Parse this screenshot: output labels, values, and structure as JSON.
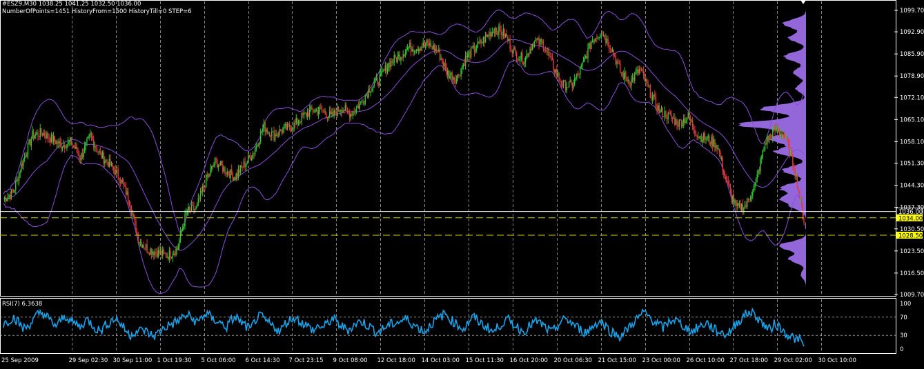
{
  "header": {
    "symbol_line": "#ESZ9,M30  1038.25 1041.25 1032.50 1036.00",
    "params_line": "NumberOfPoints=1451 HistoryFrom=1500 HistoryTill=0 STEP=6"
  },
  "colors": {
    "background": "#000000",
    "candle_up": "#32c832",
    "candle_down": "#e03c3c",
    "bands": "#8a4fd6",
    "profile": "#9b6be6",
    "rsi_line": "#1aa3ea",
    "grid": "#b4b4b4",
    "level_line": "#d2d200",
    "price_line": "#ffffff",
    "axis_text": "#ffffff",
    "tag_yellow": "#ffff00"
  },
  "chart_data": [
    {
      "type": "candlestick",
      "symbol": "#ESZ9",
      "timeframe": "M30",
      "ohlc_last": {
        "open": 1038.25,
        "high": 1041.25,
        "low": 1032.5,
        "close": 1036.0
      },
      "ylim": [
        1009.7,
        1103.5
      ],
      "y_ticks": [
        "1099.70",
        "1092.90",
        "1085.90",
        "1078.90",
        "1072.10",
        "1065.10",
        "1058.10",
        "1051.30",
        "1044.30",
        "1037.30",
        "1030.50",
        "1023.50",
        "1016.50",
        "1009.70"
      ],
      "x_ticks": [
        "25 Sep 2009",
        "29 Sep 02:30",
        "30 Sep 11:00",
        "1 Oct 19:30",
        "5 Oct 06:00",
        "6 Oct 14:30",
        "7 Oct 23:15",
        "9 Oct 08:00",
        "12 Oct 18:00",
        "14 Oct 03:00",
        "15 Oct 11:30",
        "16 Oct 20:00",
        "20 Oct 06:30",
        "21 Oct 15:00",
        "23 Oct 00:00",
        "26 Oct 10:00",
        "27 Oct 18:00",
        "29 Oct 02:00",
        "30 Oct 10:00"
      ],
      "price_path": [
        1040,
        1042,
        1052,
        1060,
        1061,
        1059,
        1057,
        1058,
        1053,
        1060,
        1054,
        1051,
        1047,
        1040,
        1027,
        1024,
        1023,
        1022,
        1024,
        1036,
        1037,
        1046,
        1052,
        1049,
        1047,
        1051,
        1055,
        1063,
        1060,
        1062,
        1063,
        1066,
        1068,
        1068,
        1066,
        1069,
        1067,
        1070,
        1075,
        1078,
        1083,
        1085,
        1088,
        1088,
        1089,
        1087,
        1080,
        1078,
        1085,
        1088,
        1091,
        1094,
        1092,
        1086,
        1084,
        1090,
        1089,
        1082,
        1076,
        1076,
        1082,
        1090,
        1093,
        1088,
        1080,
        1077,
        1081,
        1074,
        1068,
        1066,
        1064,
        1066,
        1060,
        1059,
        1057,
        1045,
        1037,
        1038,
        1045,
        1058,
        1062,
        1060,
        1050,
        1033
      ],
      "price_line": {
        "value": 1036.0,
        "label": "1036.00"
      },
      "levels": [
        {
          "value": 1034.0,
          "label": "1034.00"
        },
        {
          "value": 1028.5,
          "label": "1028.50"
        }
      ],
      "volume_profile_peaks": [
        {
          "price": 1095.5,
          "weight": 0.28
        },
        {
          "price": 1091.0,
          "weight": 0.2
        },
        {
          "price": 1085.0,
          "weight": 0.26
        },
        {
          "price": 1080.0,
          "weight": 0.16
        },
        {
          "price": 1075.0,
          "weight": 0.12
        },
        {
          "price": 1068.5,
          "weight": 0.52
        },
        {
          "price": 1063.5,
          "weight": 0.8
        },
        {
          "price": 1059.0,
          "weight": 0.44
        },
        {
          "price": 1055.0,
          "weight": 0.36
        },
        {
          "price": 1049.0,
          "weight": 0.28
        },
        {
          "price": 1043.5,
          "weight": 0.3
        },
        {
          "price": 1040.0,
          "weight": 0.26
        },
        {
          "price": 1037.5,
          "weight": 0.14
        },
        {
          "price": 1025.0,
          "weight": 0.32
        },
        {
          "price": 1021.0,
          "weight": 0.2
        },
        {
          "price": 1016.0,
          "weight": 0.06
        }
      ]
    },
    {
      "type": "line",
      "title": "RSI(7) 6.3638",
      "ylim": [
        0,
        100
      ],
      "y_ticks": [
        "100",
        "70",
        "30",
        "0"
      ],
      "levels": [
        70,
        30
      ],
      "series": [
        {
          "name": "RSI(7)",
          "last_value": 6.3638,
          "values": [
            55,
            62,
            70,
            60,
            45,
            50,
            62,
            75,
            80,
            70,
            58,
            50,
            66,
            72,
            60,
            55,
            48,
            65,
            58,
            45,
            40,
            52,
            60,
            68,
            58,
            44,
            30,
            38,
            40,
            42,
            34,
            28,
            36,
            46,
            52,
            56,
            62,
            70,
            74,
            66,
            58,
            72,
            78,
            66,
            62,
            55,
            48,
            64,
            70,
            58,
            50,
            42,
            66,
            72,
            62,
            54,
            48,
            38,
            55,
            64,
            70,
            62,
            55,
            48,
            40,
            52,
            46,
            60,
            66,
            55,
            48,
            42,
            50,
            58,
            60,
            52,
            46,
            36,
            42,
            50,
            55,
            58,
            62,
            66,
            58,
            50,
            44,
            38,
            54,
            62,
            70,
            78,
            66,
            58,
            50,
            44,
            62,
            70,
            60,
            52,
            46,
            36,
            50,
            58,
            64,
            56,
            48,
            38,
            46,
            56,
            60,
            54,
            44,
            36,
            48,
            60,
            66,
            58,
            50,
            42,
            36,
            44,
            56,
            60,
            52,
            40,
            34,
            28,
            36,
            48,
            60,
            70,
            80,
            72,
            62,
            54,
            46,
            58,
            66,
            60,
            52,
            44,
            38,
            46,
            52,
            58,
            48,
            40,
            36,
            32,
            42,
            56,
            66,
            76,
            82,
            74,
            62,
            50,
            42,
            56,
            48,
            36,
            30,
            24,
            12,
            6
          ]
        }
      ]
    }
  ]
}
